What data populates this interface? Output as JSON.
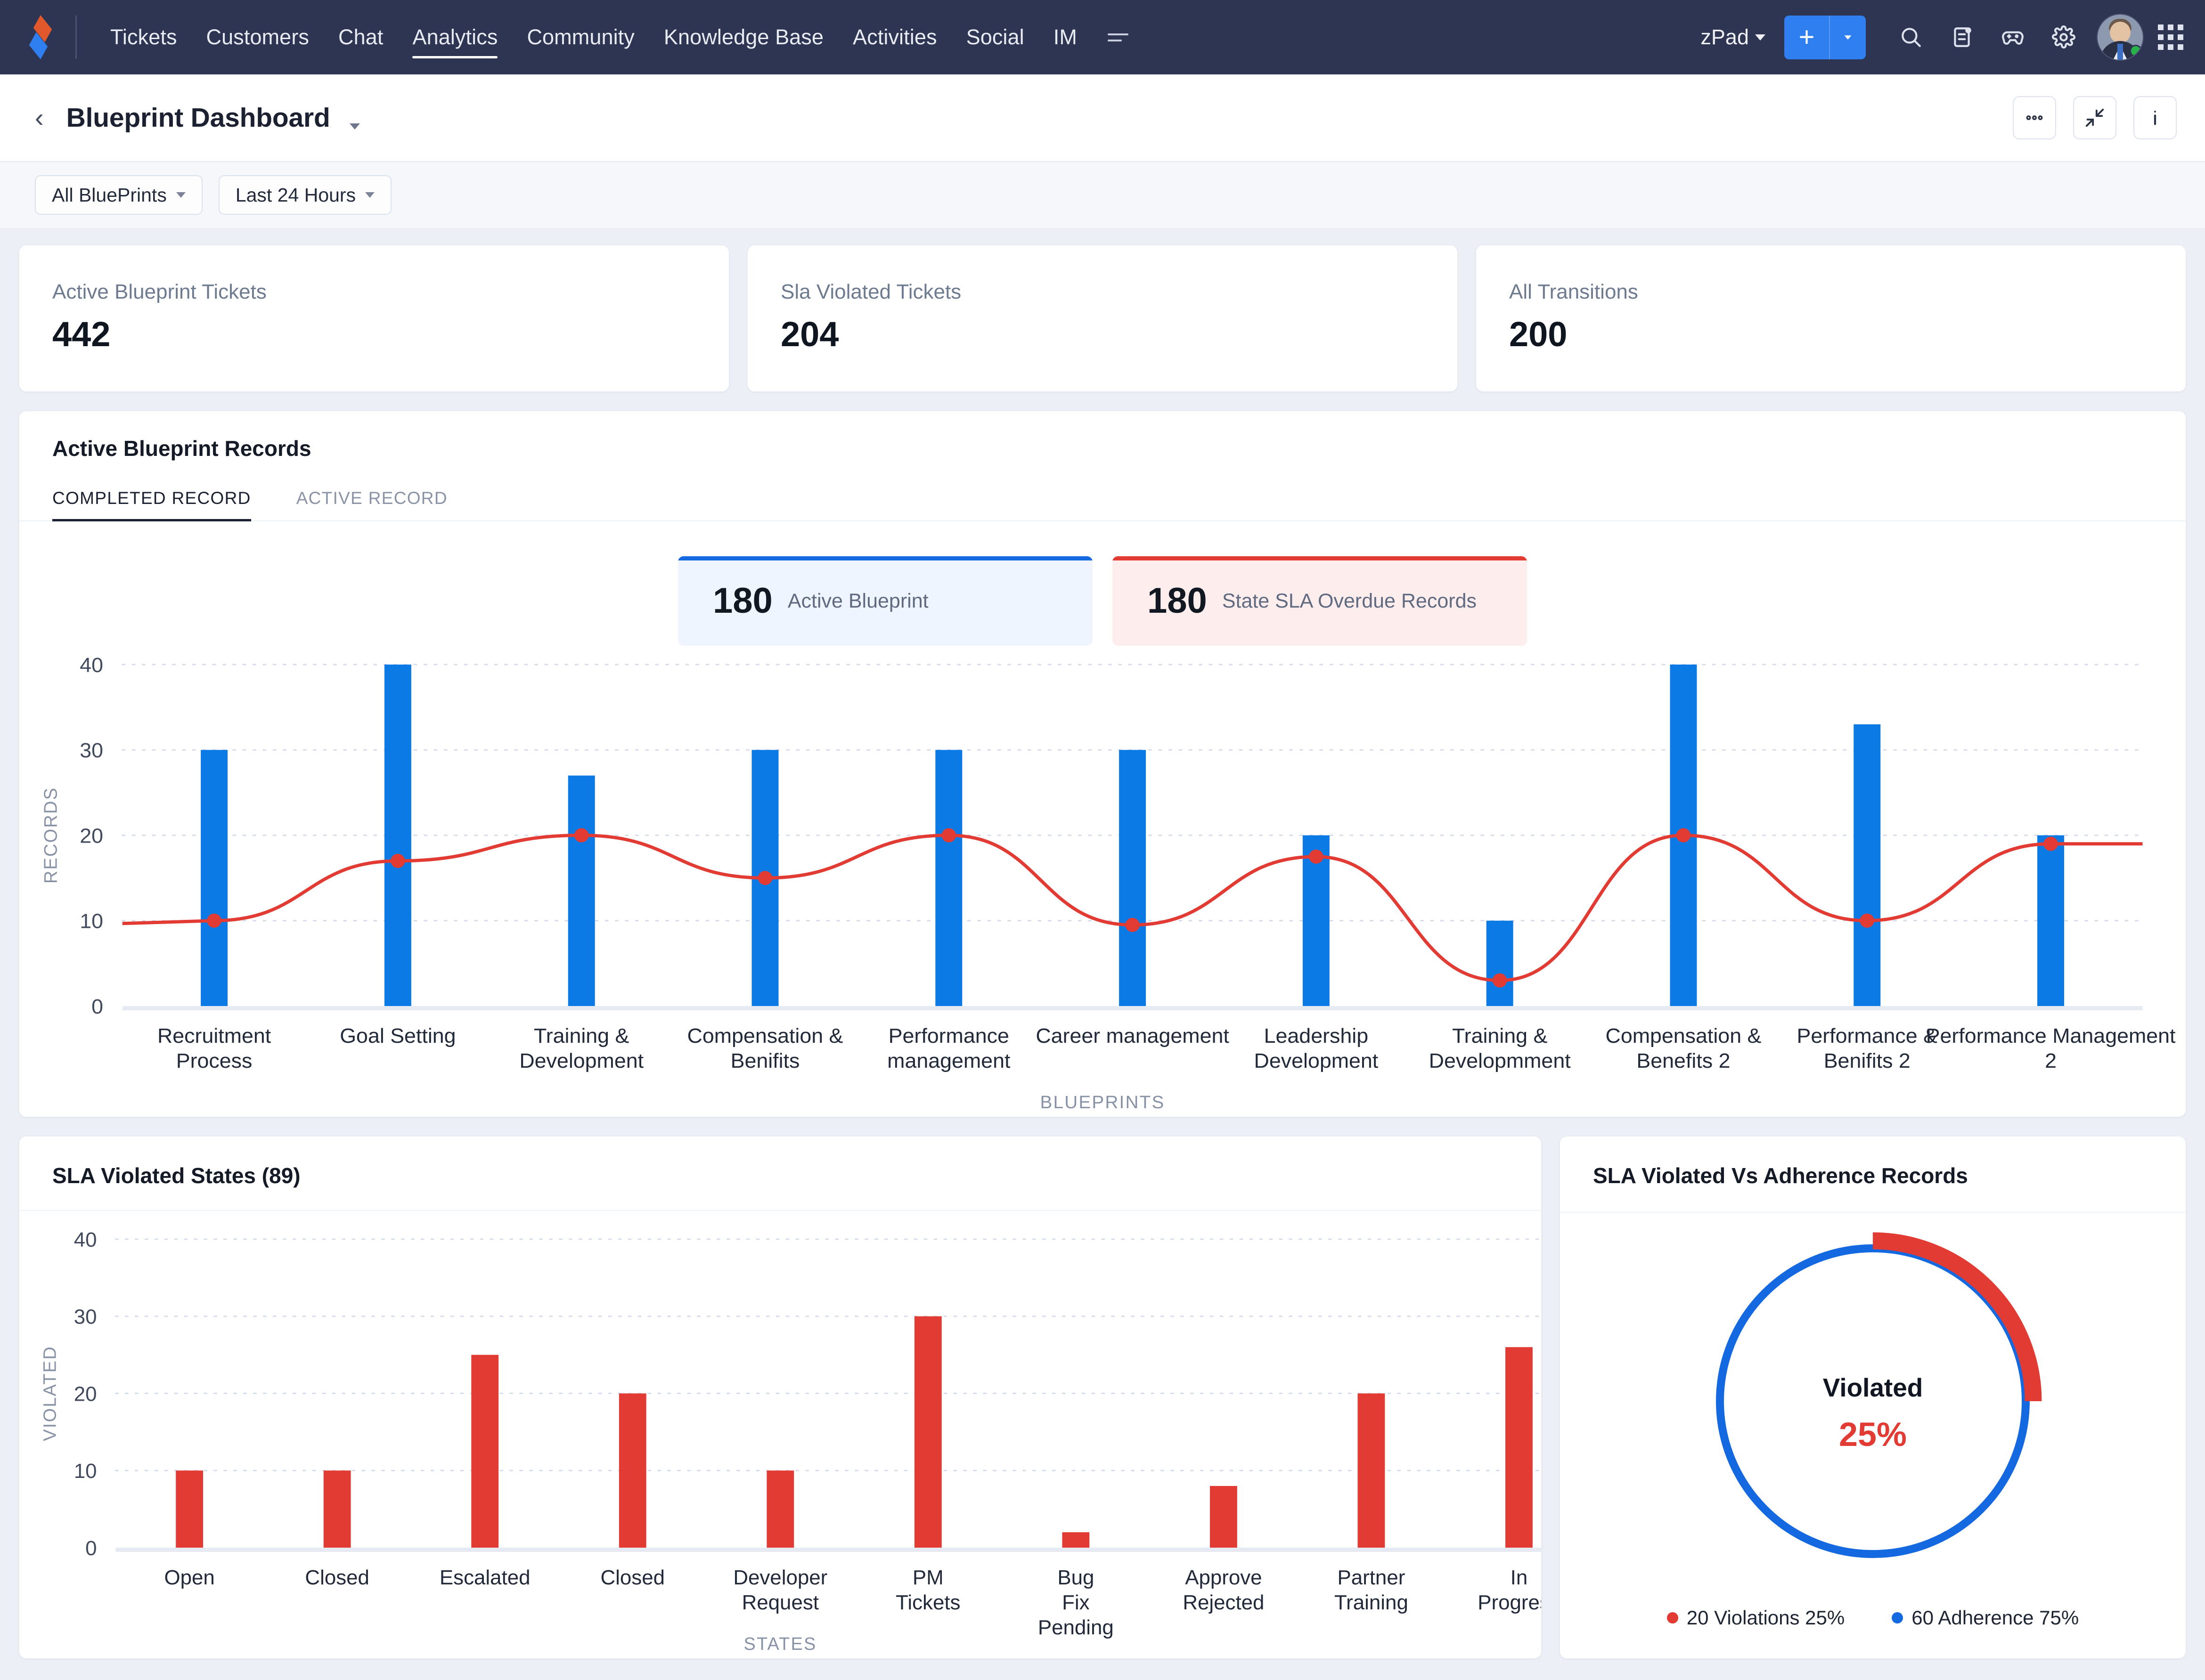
{
  "topnav": {
    "logo_icon": "zoho-desk-logo",
    "links": [
      {
        "label": "Tickets",
        "active": false
      },
      {
        "label": "Customers",
        "active": false
      },
      {
        "label": "Chat",
        "active": false
      },
      {
        "label": "Analytics",
        "active": true
      },
      {
        "label": "Community",
        "active": false
      },
      {
        "label": "Knowledge Base",
        "active": false
      },
      {
        "label": "Activities",
        "active": false
      },
      {
        "label": "Social",
        "active": false
      },
      {
        "label": "IM",
        "active": false
      }
    ],
    "more_icon": "more-menu-icon",
    "zpad_label": "zPad",
    "add_button": {
      "label": "+",
      "dropdown_icon": "chevron-down-icon"
    },
    "icons": [
      "search-icon",
      "notes-icon",
      "game-controller-icon",
      "gear-icon"
    ],
    "avatar_icon": "user-avatar",
    "apps_icon": "apps-grid-icon",
    "accent_color": "#2f7ff0",
    "background_color": "#2e3552"
  },
  "pagehead": {
    "back_icon": "back-chevron-icon",
    "title": "Blueprint Dashboard",
    "title_caret_icon": "chevron-down-icon",
    "actions": [
      {
        "name": "more-options-button",
        "icon": "ellipsis-icon"
      },
      {
        "name": "collapse-button",
        "icon": "collapse-arrows-icon"
      },
      {
        "name": "info-button",
        "icon": "info-icon"
      }
    ]
  },
  "filters": [
    {
      "label": "All BluePrints",
      "caret_icon": "chevron-down-icon"
    },
    {
      "label": "Last 24 Hours",
      "caret_icon": "chevron-down-icon"
    }
  ],
  "kpis": [
    {
      "label": "Active Blueprint Tickets",
      "value": "442"
    },
    {
      "label": "Sla Violated Tickets",
      "value": "204"
    },
    {
      "label": "All Transitions",
      "value": "200"
    }
  ],
  "records_panel": {
    "title": "Active Blueprint Records",
    "tabs": [
      {
        "label": "COMPLETED RECORD",
        "active": true
      },
      {
        "label": "ACTIVE RECORD",
        "active": false
      }
    ],
    "badges": [
      {
        "value": "180",
        "label": "Active Blueprint",
        "color": "#1569e0",
        "bg": "#eef5fe"
      },
      {
        "value": "180",
        "label": "State SLA Overdue Records",
        "color": "#e23b33",
        "bg": "#fdeded"
      }
    ]
  },
  "sla_panel": {
    "title": "SLA Violated States (89)"
  },
  "donut_panel": {
    "title": "SLA Violated Vs Adherence Records",
    "center_label": "Violated",
    "center_value": "25%",
    "legend": [
      {
        "label": "20 Violations 25%",
        "color": "#e23b33"
      },
      {
        "label": "60 Adherence 75%",
        "color": "#1569e0"
      }
    ]
  },
  "chart_data": [
    {
      "type": "bar",
      "name": "blueprint-records-chart",
      "title": "",
      "xlabel": "BLUEPRINTS",
      "ylabel": "RECORDS",
      "ylim": [
        0,
        40
      ],
      "yticks": [
        0,
        10,
        20,
        30,
        40
      ],
      "grid": true,
      "bar_color": "#0c7ae5",
      "line_color": "#e23b33",
      "categories": [
        "Recruitment Process",
        "Goal Setting",
        "Training & Development",
        "Compensation & Benifits",
        "Performance management",
        "Career management",
        "Leadership Development",
        "Training & Developmment",
        "Compensation & Benefits 2",
        "Performance & Benifits 2",
        "Performance Management 2"
      ],
      "series": [
        {
          "name": "Records",
          "type": "bar",
          "values": [
            30,
            40,
            27,
            30,
            30,
            30,
            20,
            10,
            40,
            33,
            20
          ]
        },
        {
          "name": "Overdue",
          "type": "line",
          "values": [
            10,
            17,
            20,
            15,
            20,
            9.5,
            17.5,
            3,
            20,
            10,
            19
          ]
        }
      ]
    },
    {
      "type": "bar",
      "name": "sla-violated-states-chart",
      "title": "SLA Violated States (89)",
      "xlabel": "STATES",
      "ylabel": "VIOLATED",
      "ylim": [
        0,
        40
      ],
      "yticks": [
        0,
        10,
        20,
        30,
        40
      ],
      "grid": true,
      "bar_color": "#e23b33",
      "categories": [
        "Open",
        "Closed",
        "Escalated",
        "Closed",
        "Developer Request",
        "PM Tickets",
        "Bug Fix Pending",
        "Approve Rejected",
        "Partner Training",
        "In Progress"
      ],
      "values": [
        10,
        10,
        25,
        20,
        10,
        30,
        2,
        8,
        20,
        26
      ]
    },
    {
      "type": "pie",
      "name": "sla-violated-vs-adherence-donut",
      "title": "SLA Violated Vs Adherence Records",
      "labels": [
        "Violations",
        "Adherence"
      ],
      "values": [
        20,
        60
      ],
      "percents": [
        25,
        75
      ],
      "colors": [
        "#e23b33",
        "#1569e0"
      ],
      "center_label": "Violated",
      "center_value": "25%",
      "legend_position": "bottom"
    }
  ]
}
